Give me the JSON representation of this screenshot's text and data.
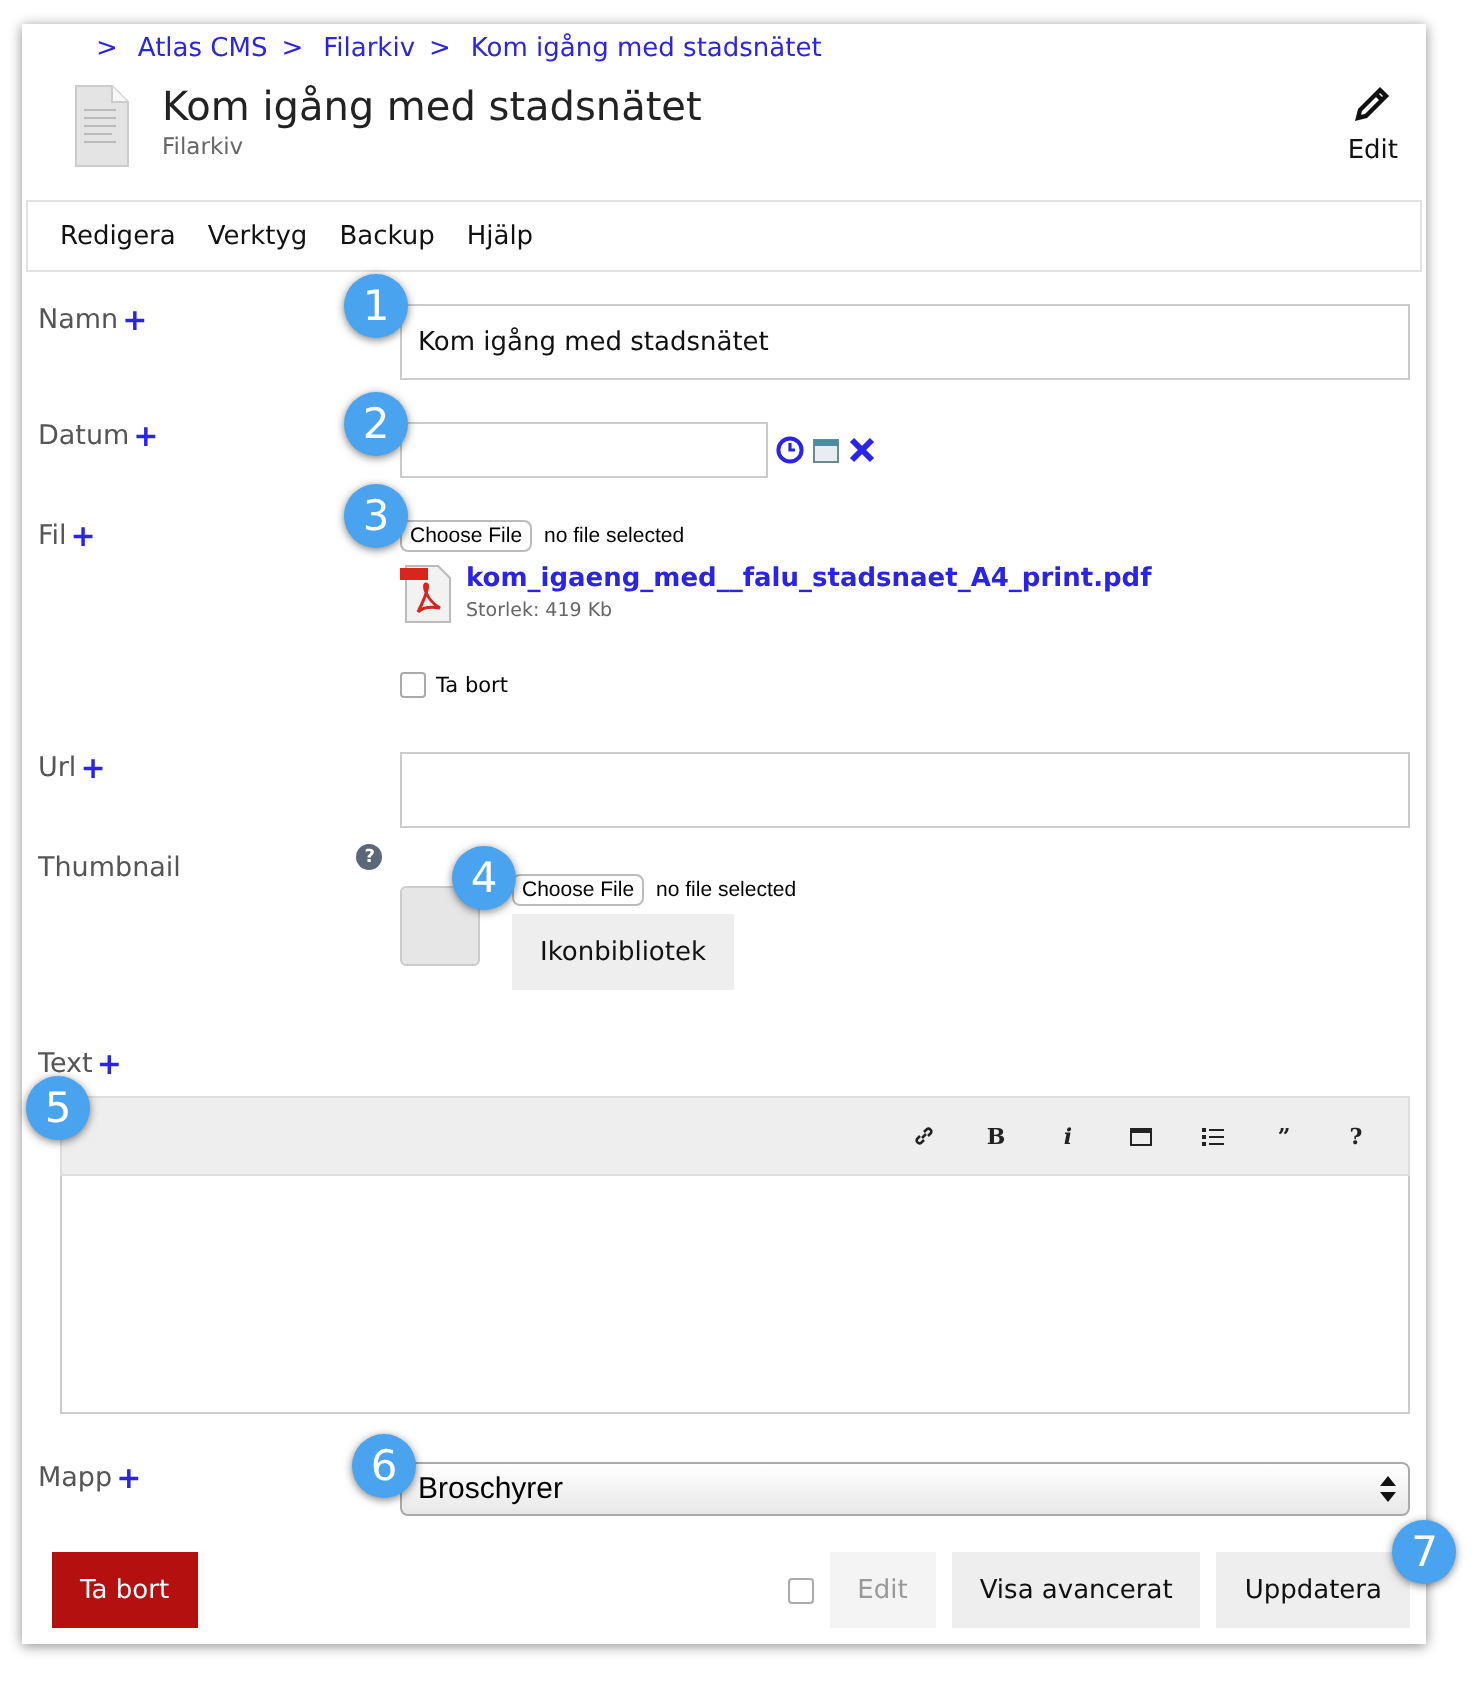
{
  "breadcrumb": [
    {
      "separator": ">",
      "label": "Atlas CMS"
    },
    {
      "separator": ">",
      "label": "Filarkiv"
    },
    {
      "separator": ">",
      "label": "Kom igång med stadsnätet"
    }
  ],
  "header": {
    "title": "Kom igång med stadsnätet",
    "subtitle": "Filarkiv",
    "edit_label": "Edit"
  },
  "menu": [
    "Redigera",
    "Verktyg",
    "Backup",
    "Hjälp"
  ],
  "fields": [
    {
      "kind": "text",
      "label": "Namn",
      "plus": "+",
      "value": "Kom igång med stadsnätet",
      "callout": "1"
    },
    {
      "kind": "date",
      "label": "Datum",
      "plus": "+",
      "callout": "2"
    },
    {
      "kind": "file",
      "label": "Fil",
      "plus": "+",
      "callout": "3",
      "choose": "Choose File",
      "status": "no file selected",
      "file_name": "kom_igaeng_med__falu_stadsnaet_A4_print.pdf",
      "file_size": "Storlek: 419 Kb",
      "remove_label": "Ta bort",
      "remove_checked": false
    },
    {
      "kind": "url",
      "label": "Url",
      "plus": "+"
    },
    {
      "kind": "thumbnail",
      "label": "Thumbnail",
      "help": "?",
      "callout": "4",
      "choose": "Choose File",
      "status": "no file selected",
      "library": "Ikonbibliotek"
    },
    {
      "kind": "editor",
      "label": "Text",
      "plus": "+",
      "callout": "5",
      "tools": [
        {
          "kind": "link"
        },
        {
          "kind": "glyph",
          "label": "B"
        },
        {
          "kind": "glyph",
          "label": "i"
        },
        {
          "kind": "box"
        },
        {
          "kind": "list"
        },
        {
          "kind": "glyph",
          "label": "”"
        },
        {
          "kind": "glyph",
          "label": "?"
        }
      ]
    },
    {
      "kind": "select",
      "label": "Mapp",
      "plus": "+",
      "value": "Broschyrer",
      "callout": "6"
    }
  ],
  "footer": {
    "delete": "Ta bort",
    "edit_checked": false,
    "edit": "Edit",
    "edit_disabled": true,
    "advanced": "Visa avancerat",
    "update": "Uppdatera",
    "update_callout": "7"
  }
}
